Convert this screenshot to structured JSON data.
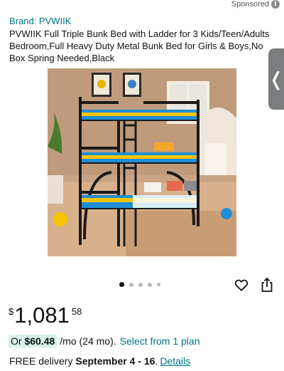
{
  "header": {
    "sponsored_label": "Sponsored",
    "info_icon": "info-icon"
  },
  "product": {
    "brand_link": "Brand: PVWIIK",
    "title": "PVWIIK Full Triple Bunk Bed with Ladder for 3 Kids/Teen/Adults Bedroom,Full Heavy Duty Metal Bunk Bed for Girls & Boys,No Box Spring Needed,Black"
  },
  "gallery": {
    "image_count": 5,
    "active_index": 0,
    "side_handle_glyph": "❬"
  },
  "actions": {
    "wishlist_icon": "heart-icon",
    "share_icon": "share-icon"
  },
  "price": {
    "symbol": "$",
    "whole": "1,081",
    "fraction": "58"
  },
  "installment": {
    "prefix": "Or ",
    "amount": "$60.48",
    "term": "/mo (24 mo).",
    "link": "Select from 1 plan"
  },
  "delivery": {
    "prefix": "FREE delivery ",
    "dates": "September 4 - 16",
    "separator": ".",
    "link": "Details"
  },
  "colors": {
    "link": "#007185",
    "installment_highlight": "#d7f0ea",
    "text": "#0f1111"
  }
}
